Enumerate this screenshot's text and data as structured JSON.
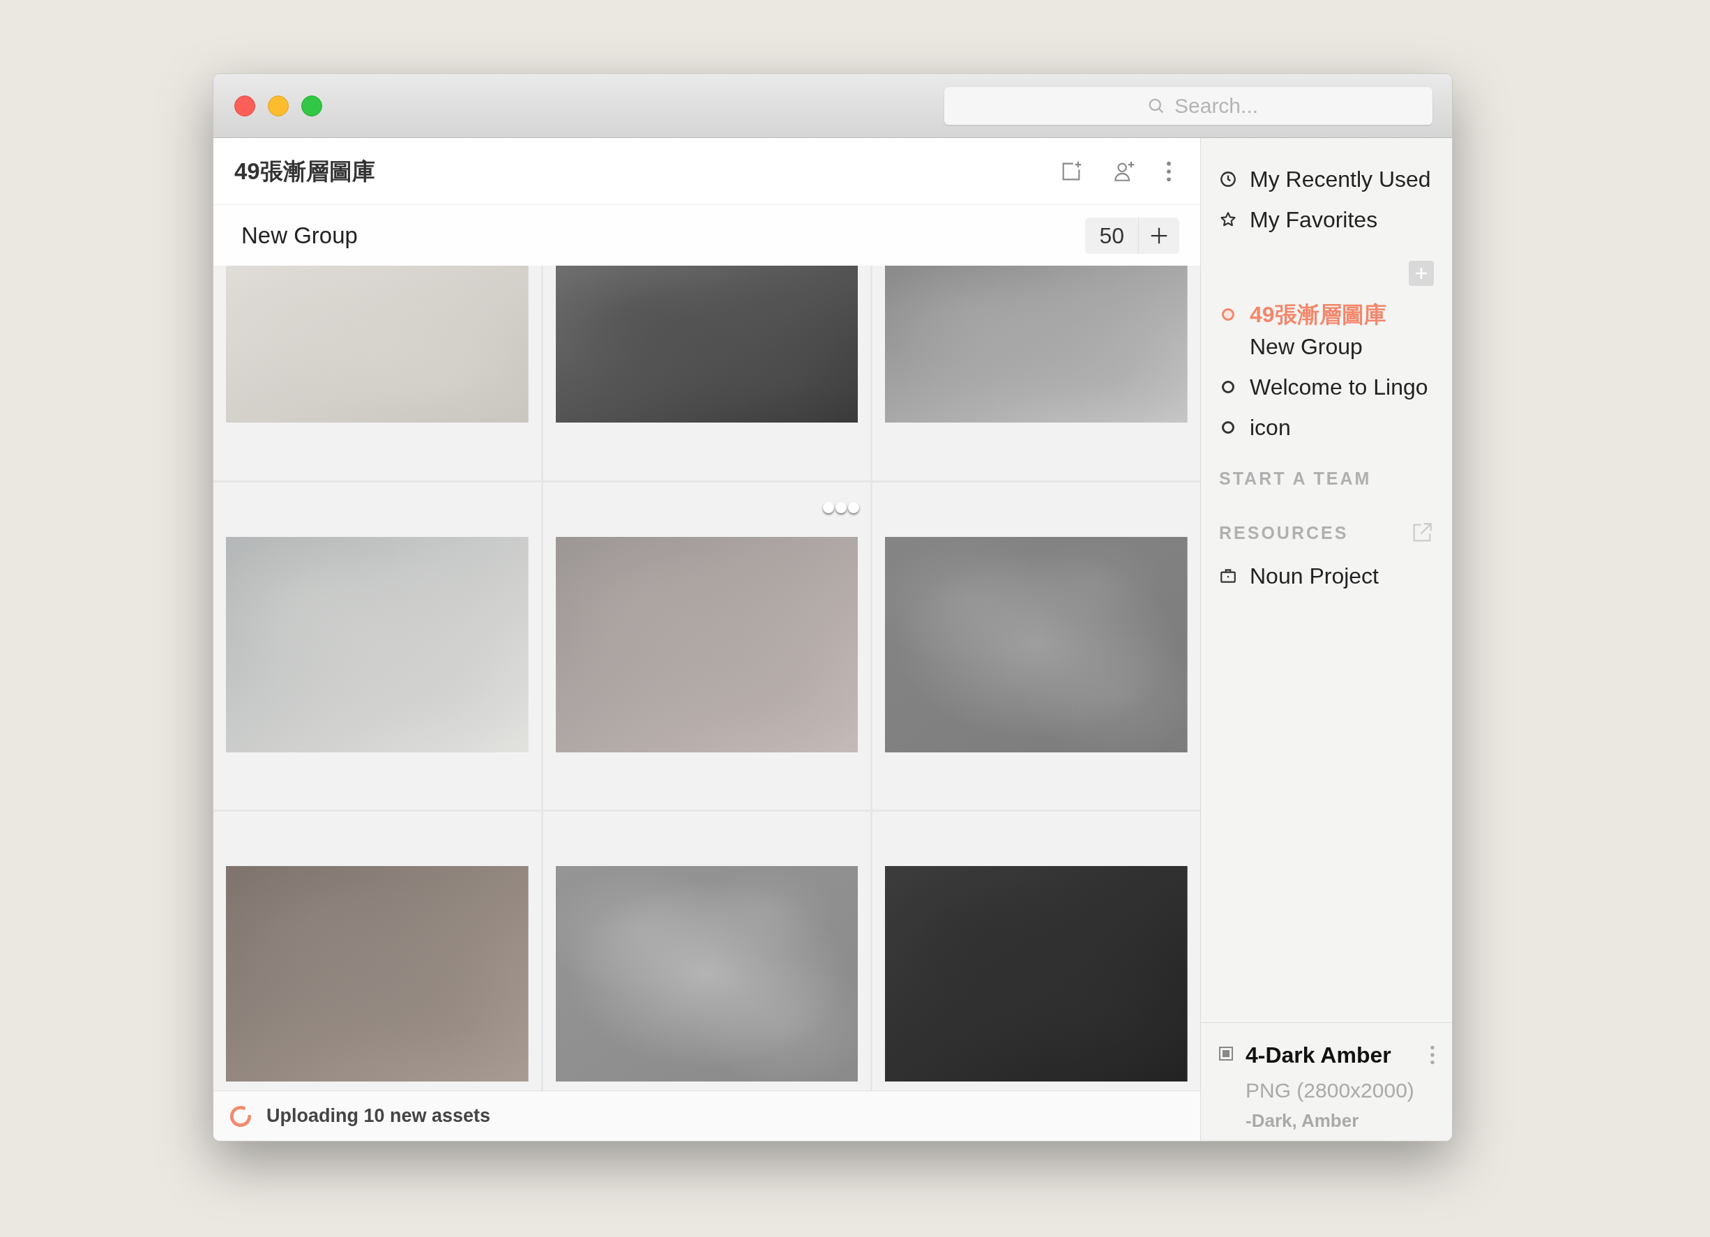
{
  "window": {
    "search": {
      "placeholder": "Search..."
    }
  },
  "library": {
    "title": "49張漸層圖庫",
    "group": {
      "name": "New Group",
      "count": "50"
    }
  },
  "thumbnails": [
    {
      "kind": "picture",
      "menu": false
    },
    {
      "kind": "picture",
      "menu": false
    },
    {
      "kind": "picture",
      "menu": false
    },
    {
      "kind": "picture",
      "menu": false
    },
    {
      "kind": "picture",
      "menu": true
    },
    {
      "kind": "picture",
      "menu": false
    },
    {
      "kind": "picture",
      "menu": false
    },
    {
      "kind": "picture",
      "menu": false
    },
    {
      "kind": "picture",
      "menu": false
    }
  ],
  "status": {
    "text": "Uploading 10 new assets",
    "uploading": true
  },
  "sidebar": {
    "shortcuts": [
      {
        "label": "My Recently Used",
        "kind": "recent"
      },
      {
        "label": "My Favorites",
        "kind": "favorites"
      }
    ],
    "libraries": [
      {
        "label": "49張漸層圖庫",
        "selected": true,
        "children": [
          {
            "label": "New Group"
          }
        ]
      },
      {
        "label": "Welcome to Lingo",
        "selected": false
      },
      {
        "label": "icon",
        "selected": false
      }
    ],
    "team_heading": "START A TEAM",
    "resources_heading": "RESOURCES",
    "resources": [
      {
        "label": "Noun Project"
      }
    ]
  },
  "detail": {
    "name": "4-Dark Amber",
    "format": "PNG (2800x2000)",
    "tags": "-Dark, Amber"
  }
}
